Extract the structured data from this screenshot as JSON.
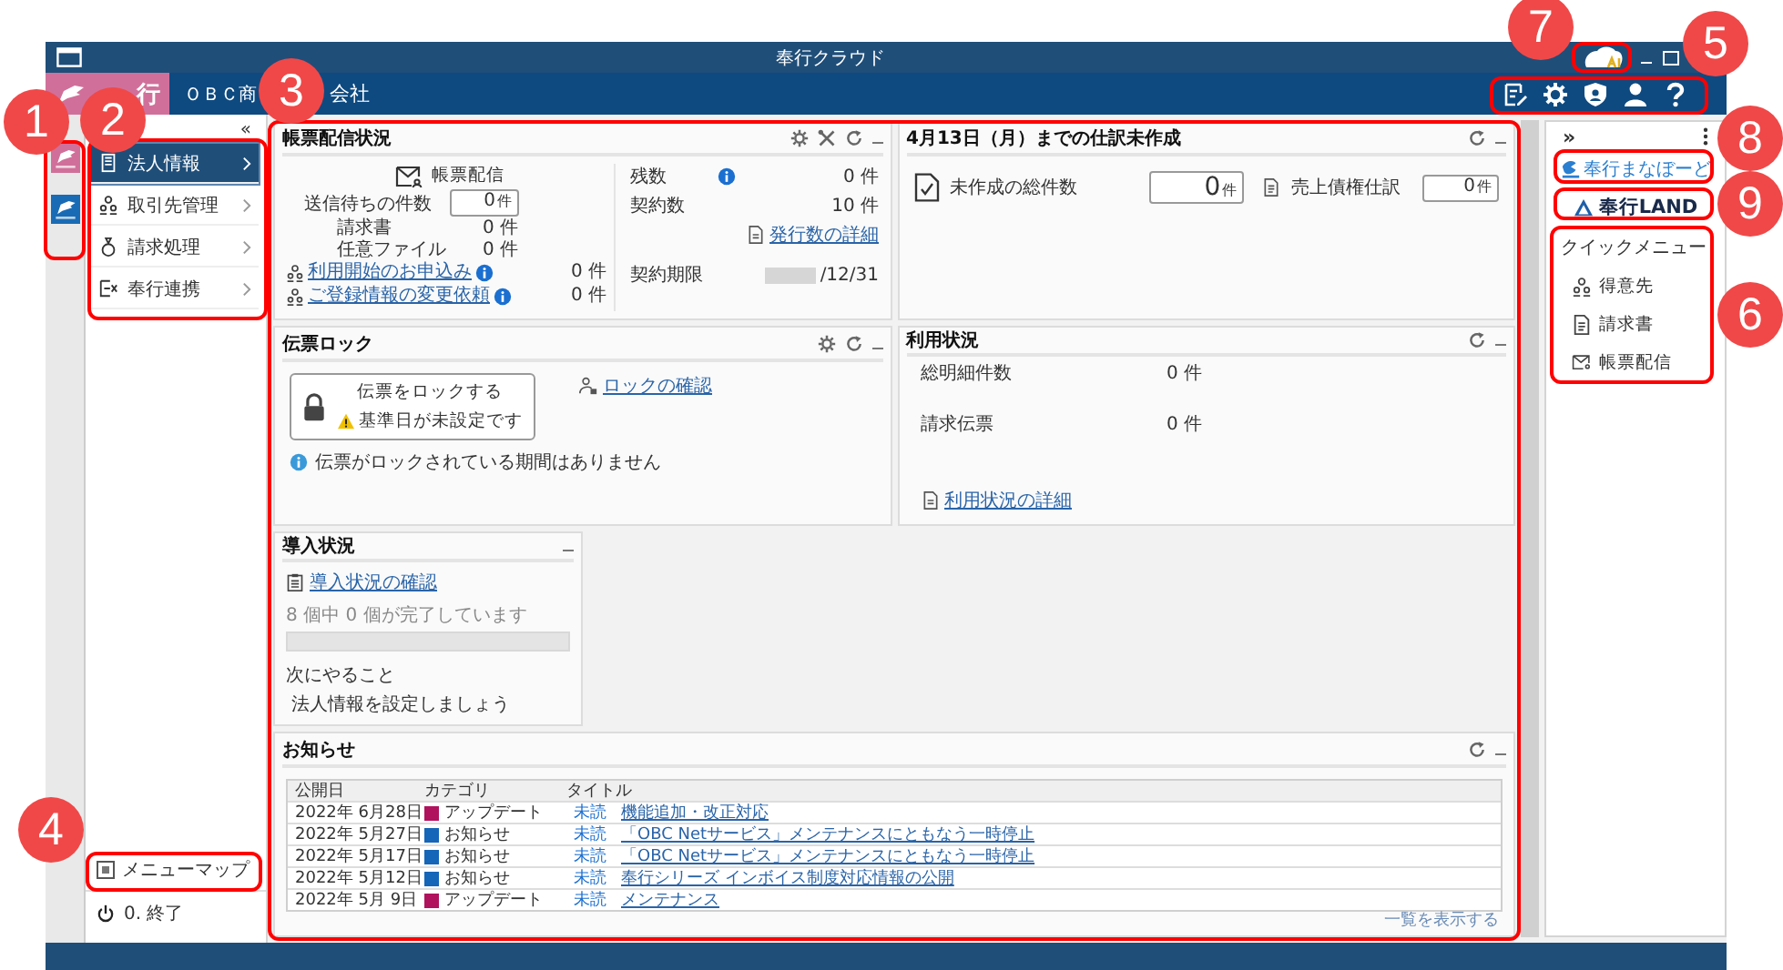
{
  "window": {
    "title": "奉行クラウド"
  },
  "header": {
    "logo_text": "行",
    "company_name_start": "ＯＢＣ商",
    "company_name_end": "会社"
  },
  "nav": {
    "collapse": "«",
    "items": [
      {
        "label": "法人情報",
        "selected": true,
        "kind": "building"
      },
      {
        "label": "取引先管理",
        "selected": false,
        "kind": "people"
      },
      {
        "label": "請求処理",
        "selected": false,
        "kind": "money"
      },
      {
        "label": "奉行連携",
        "selected": false,
        "kind": "link"
      }
    ],
    "menu_map": "メニューマップ",
    "exit": "0. 終了"
  },
  "delivery": {
    "title": "帳票配信状況",
    "service": "帳票配信",
    "pending_label": "送信待ちの件数",
    "pending_value": "0",
    "pending_unit": "件",
    "breakdown": [
      {
        "label": "請求書",
        "value": "0 件"
      },
      {
        "label": "任意ファイル",
        "value": "0 件"
      }
    ],
    "links": [
      {
        "label": "利用開始のお申込み",
        "value": "0 件"
      },
      {
        "label": "ご登録情報の変更依頼",
        "value": "0 件"
      }
    ],
    "remaining_label": "残数",
    "remaining_value": "0 件",
    "contract_label": "契約数",
    "contract_value": "10 件",
    "detail_link": "発行数の詳細",
    "period_label": "契約期限",
    "period_value": "/12/31"
  },
  "journal": {
    "title": "4月13日（月）までの仕訳未作成",
    "items": [
      {
        "label": "未作成の総件数",
        "value": "0",
        "unit": "件",
        "kind": "large"
      },
      {
        "label": "売上債権仕訳",
        "value": "0",
        "unit": "件",
        "kind": "small"
      }
    ]
  },
  "lock": {
    "title": "伝票ロック",
    "button_label": "伝票をロックする",
    "warning": "基準日が未設定です",
    "link": "ロックの確認",
    "info": "伝票がロックされている期間はありません"
  },
  "usage": {
    "title": "利用状況",
    "rows": [
      {
        "label": "総明細件数",
        "value": "0 件"
      },
      {
        "label": "請求伝票",
        "value": "0 件"
      }
    ],
    "link": "利用状況の詳細"
  },
  "intro": {
    "title": "導入状況",
    "link": "導入状況の確認",
    "progress_text": "8 個中 0 個が完了しています",
    "level": 0,
    "next_label": "次にやること",
    "next_text": "法人情報を設定しましょう"
  },
  "news": {
    "title": "お知らせ",
    "columns": [
      "公開日",
      "カテゴリ",
      "タイトル"
    ],
    "rows": [
      {
        "date": "2022年 6月28日",
        "category": "アップデート",
        "color": "#b0125e",
        "status": "未読",
        "title": "機能追加・改正対応"
      },
      {
        "date": "2022年 5月27日",
        "category": "お知らせ",
        "color": "#1565b8",
        "status": "未読",
        "title": "「OBC Netサービス」メンテナンスにともなう一時停止"
      },
      {
        "date": "2022年 5月17日",
        "category": "お知らせ",
        "color": "#1565b8",
        "status": "未読",
        "title": "「OBC Netサービス」メンテナンスにともなう一時停止"
      },
      {
        "date": "2022年 5月12日",
        "category": "お知らせ",
        "color": "#1565b8",
        "status": "未読",
        "title": "奉行シリーズ インボイス制度対応情報の公開"
      },
      {
        "date": "2022年 5月 9日",
        "category": "アップデート",
        "color": "#b0125e",
        "status": "未読",
        "title": "メンテナンス"
      }
    ],
    "more_link": "一覧を表示する"
  },
  "right_panel": {
    "expand": "»",
    "manabo": "奉行まなぼーど",
    "land": "奉行LAND",
    "quick_title": "クイックメニュー",
    "quick_items": [
      {
        "label": "得意先",
        "kind": "people"
      },
      {
        "label": "請求書",
        "kind": "doc"
      },
      {
        "label": "帳票配信",
        "kind": "mail"
      }
    ]
  },
  "callouts": [
    {
      "number": "1"
    },
    {
      "number": "2"
    },
    {
      "number": "3"
    },
    {
      "number": "4"
    },
    {
      "number": "5"
    },
    {
      "number": "6"
    },
    {
      "number": "7"
    },
    {
      "number": "8"
    },
    {
      "number": "9"
    }
  ]
}
